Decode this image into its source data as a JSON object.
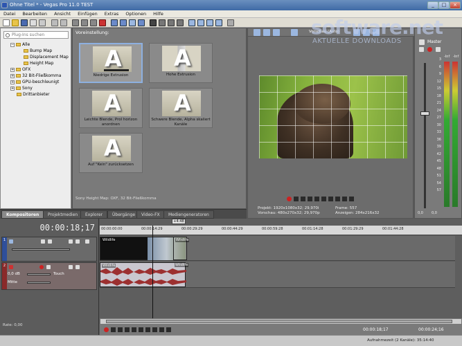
{
  "window": {
    "title": "Ohne Titel * - Vegas Pro 11.0 TEST",
    "min": "_",
    "max": "□",
    "close": "×"
  },
  "menu": [
    "Datei",
    "Bearbeiten",
    "Ansicht",
    "Einfügen",
    "Extras",
    "Optionen",
    "Hilfe"
  ],
  "explorer": {
    "search_placeholder": "Plug-Ins suchen",
    "tree": [
      {
        "label": "Alle",
        "level": 0,
        "expand": "−"
      },
      {
        "label": "Bump Map",
        "level": 1
      },
      {
        "label": "Displacement Map",
        "level": 1
      },
      {
        "label": "Height Map",
        "level": 1
      },
      {
        "label": "OFX",
        "level": 0,
        "expand": "+"
      },
      {
        "label": "32 Bit-Fließkomma",
        "level": 0,
        "expand": "+"
      },
      {
        "label": "GPU-beschleunigt",
        "level": 0,
        "expand": "+"
      },
      {
        "label": "Sony",
        "level": 0,
        "expand": "+"
      },
      {
        "label": "Drittanbieter",
        "level": 0
      }
    ]
  },
  "presets": {
    "title": "Voreinstellung:",
    "items": [
      {
        "caption": "Niedrige Extrusion",
        "glyph": "A"
      },
      {
        "caption": "Hohe Extrusion",
        "glyph": "A"
      },
      {
        "caption": "Leichte Blende, Prol horizon anordnen",
        "glyph": "A"
      },
      {
        "caption": "Schwere Blende, Alpha skaliert Kanäle",
        "glyph": "A"
      },
      {
        "caption": "Auf \"Kein\" zurücksetzen",
        "glyph": "A"
      }
    ],
    "status": "Sony Height Map: OXF, 32 Bit-Fließkomma"
  },
  "tabs": [
    "Kompositoren",
    "Projektmedien",
    "Explorer",
    "Übergänge",
    "Video-FX",
    "Mediengeneratoren"
  ],
  "preview": {
    "quality": "Vorschau (Auto)",
    "info_left_1": "Projekt:   1920x1080x32; 29,970i",
    "info_left_2": "Vorschau:  480x270x32; 29,970p",
    "info_right_1": "Frame:     557",
    "info_right_2": "Anzeigen:  284x216x32"
  },
  "master": {
    "title": "Master",
    "top_left": "-Inf",
    "top_right": "-Inf",
    "scale": [
      "3",
      "6",
      "9",
      "12",
      "15",
      "18",
      "21",
      "24",
      "27",
      "30",
      "33",
      "36",
      "39",
      "42",
      "45",
      "48",
      "51",
      "54",
      "57"
    ],
    "bottom_left": "0,0",
    "bottom_right": "0,0"
  },
  "timeline": {
    "timecode": "00:00:18;17",
    "loop_marker": "+4:48",
    "ruler": [
      "00:00:00:00",
      "00:00:14:29",
      "00:00:29:29",
      "00:00:44:29",
      "00:00:59:28",
      "00:01:14:28",
      "00:01:29:29",
      "00:01:44:28"
    ],
    "video_clip": "Wildlife",
    "video_clip2": "Wildlife",
    "audio_clip": "Wildlife",
    "audio_clip2": "Wildlife",
    "track1_num": "1",
    "track2_num": "2",
    "audio_vol": "0,0 dB",
    "audio_mode": "Touch",
    "audio_pan": "Mitte",
    "end_time": "00:00:18;17",
    "end_time2": "00:00:24;16"
  },
  "rate": "Rate: 0,00",
  "status_text": "Aufnahmezeit (2 Kanäle): 35:14:40",
  "watermark": {
    "big": "software.net",
    "small": "AKTUELLE DOWNLOADS"
  }
}
